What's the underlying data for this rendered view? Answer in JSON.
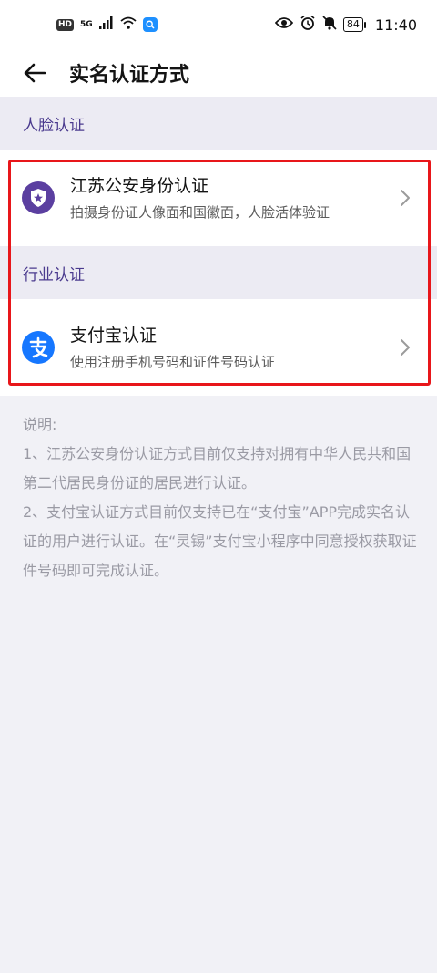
{
  "status_bar": {
    "hd": "HD",
    "network": "5G",
    "battery": "84",
    "time": "11:40"
  },
  "header": {
    "title": "实名认证方式"
  },
  "sections": [
    {
      "label": "人脸认证",
      "items": [
        {
          "title": "江苏公安身份认证",
          "description": "拍摄身份证人像面和国徽面，人脸活体验证",
          "icon": "police-badge-icon"
        }
      ]
    },
    {
      "label": "行业认证",
      "items": [
        {
          "title": "支付宝认证",
          "description": "使用注册手机号码和证件号码认证",
          "icon": "alipay-icon"
        }
      ]
    }
  ],
  "notes": {
    "heading": "说明:",
    "lines": [
      "1、江苏公安身份认证方式目前仅支持对拥有中华人民共和国第二代居民身份证的居民进行认证。",
      "2、支付宝认证方式目前仅支持已在“支付宝”APP完成实名认证的用户进行认证。在“灵锡”支付宝小程序中同意授权获取证件号码即可完成认证。"
    ]
  },
  "colors": {
    "accent": "#4a3a8e",
    "highlight": "#e8161a",
    "alipay": "#1677ff",
    "police": "#5b3fa0"
  }
}
